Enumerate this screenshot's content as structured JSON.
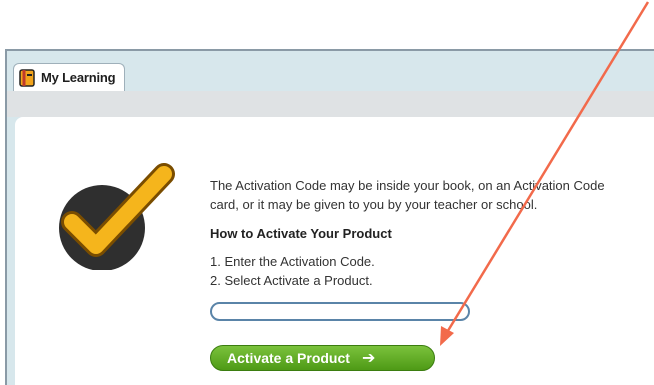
{
  "tab": {
    "label": "My Learning",
    "icon": "book-icon"
  },
  "message": {
    "intro": "The Activation Code may be inside your book, on an Activation Code card, or it may be given to you by your teacher or school.",
    "heading": "How to Activate Your Product",
    "steps": [
      "1. Enter the Activation Code.",
      "2. Select Activate a Product."
    ]
  },
  "input": {
    "value": "",
    "placeholder": ""
  },
  "button": {
    "label": "Activate a Product",
    "icon": "arrow-right-icon"
  },
  "colors": {
    "accent_green": "#5aa61c",
    "input_border": "#5a84a8",
    "annotation_arrow": "#f26a4b",
    "check_gold": "#f5b51c"
  }
}
